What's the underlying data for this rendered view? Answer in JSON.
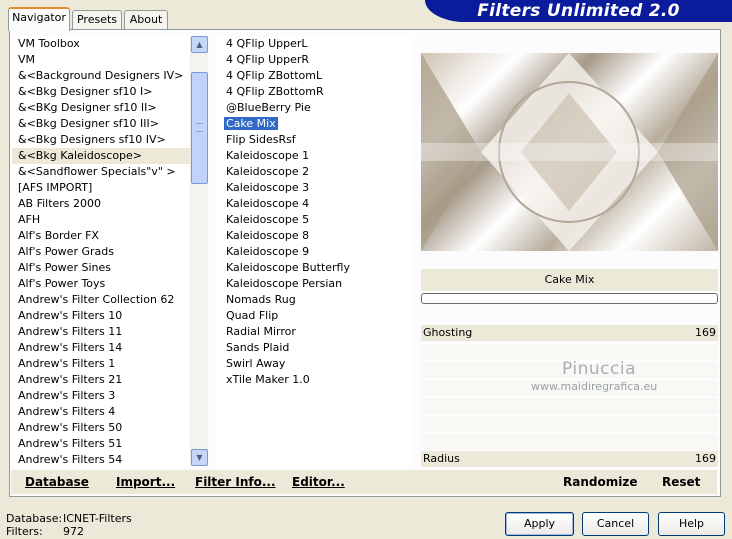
{
  "tabs": [
    {
      "label": "Navigator",
      "active": true
    },
    {
      "label": "Presets",
      "active": false
    },
    {
      "label": "About",
      "active": false
    }
  ],
  "banner_title": "Filters Unlimited 2.0",
  "categories": [
    "VM Toolbox",
    "VM",
    "&<Background Designers IV>",
    "&<Bkg Designer sf10 I>",
    "&<BKg Designer sf10 II>",
    "&<Bkg Designer sf10 III>",
    "&<Bkg Designers sf10 IV>",
    "&<Bkg Kaleidoscope>",
    "&<Sandflower Specials\"v\" >",
    "[AFS IMPORT]",
    "AB Filters 2000",
    "AFH",
    "Alf's Border FX",
    "Alf's Power Grads",
    "Alf's Power Sines",
    "Alf's Power Toys",
    "Andrew's Filter Collection 62",
    "Andrew's Filters 10",
    "Andrew's Filters 11",
    "Andrew's Filters 14",
    "Andrew's Filters 1",
    "Andrew's Filters 21",
    "Andrew's Filters 3",
    "Andrew's Filters 4",
    "Andrew's Filters 50",
    "Andrew's Filters 51",
    "Andrew's Filters 54"
  ],
  "selected_category_index": 7,
  "filters": [
    "4 QFlip UpperL",
    "4 QFlip UpperR",
    "4 QFlip ZBottomL",
    "4 QFlip ZBottomR",
    "@BlueBerry Pie",
    "Cake Mix",
    "Flip SidesRsf",
    "Kaleidoscope 1",
    "Kaleidoscope 2",
    "Kaleidoscope 3",
    "Kaleidoscope 4",
    "Kaleidoscope 5",
    "Kaleidoscope 8",
    "Kaleidoscope 9",
    "Kaleidoscope Butterfly",
    "Kaleidoscope Persian",
    "Nomads Rug",
    "Quad Flip",
    "Radial Mirror",
    "Sands Plaid",
    "Swirl Away",
    "xTile Maker 1.0"
  ],
  "selected_filter_index": 5,
  "preview": {
    "filter_name": "Cake Mix"
  },
  "params": [
    {
      "name": "Ghosting",
      "value": "169"
    },
    {
      "name": "Radius",
      "value": "169"
    }
  ],
  "watermark": {
    "line1": "Pinuccia",
    "line2": "www.maidiregrafica.eu"
  },
  "bottom_links": {
    "database": "Database",
    "import": "Import...",
    "filter_info": "Filter Info...",
    "editor": "Editor...",
    "randomize": "Randomize",
    "reset": "Reset"
  },
  "status": {
    "database_label": "Database:",
    "database_value": "ICNET-Filters",
    "filters_label": "Filters:",
    "filters_value": "972"
  },
  "buttons": {
    "apply": "Apply",
    "cancel": "Cancel",
    "help": "Help"
  },
  "colors": {
    "selection": "#316ac5",
    "banner": "#0a1b9c",
    "tab_accent": "#e68b2c"
  }
}
